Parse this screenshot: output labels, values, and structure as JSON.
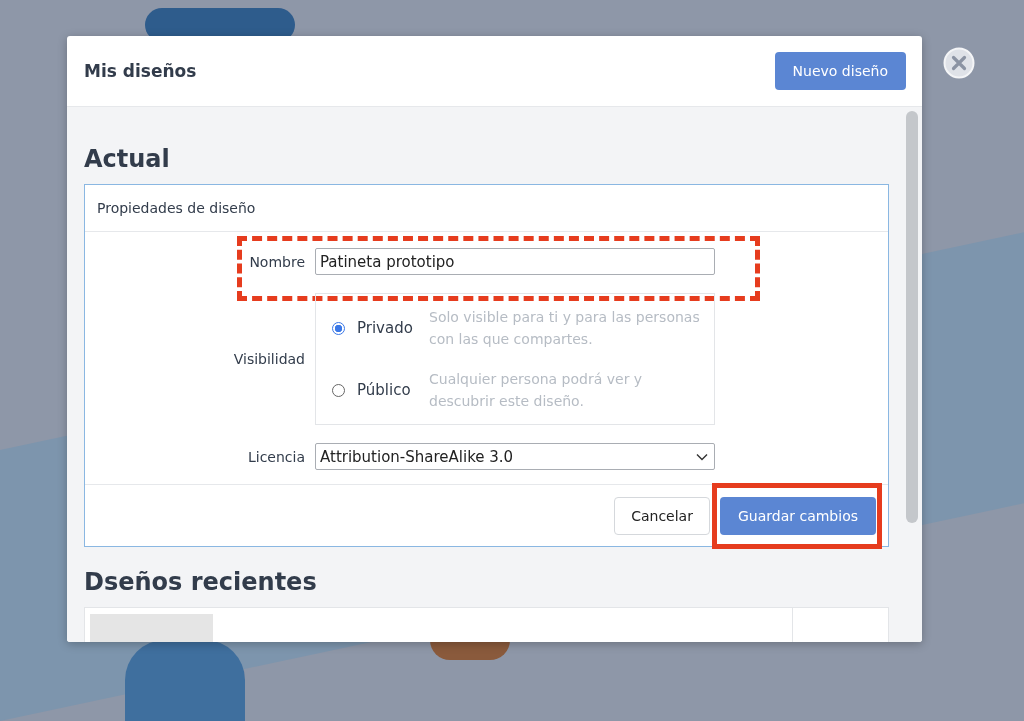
{
  "dialog": {
    "title": "Mis diseños",
    "new_button": "Nuevo diseño"
  },
  "current": {
    "heading": "Actual",
    "card_title": "Propiedades de diseño",
    "name": {
      "label": "Nombre",
      "value": "Patineta prototipo",
      "highlighted": true
    },
    "visibility": {
      "label": "Visibilidad",
      "options": [
        {
          "label": "Privado",
          "description": "Solo visible para ti y para las personas con las que compartes.",
          "selected": true
        },
        {
          "label": "Público",
          "description": "Cualquier persona podrá ver y descubrir este diseño.",
          "selected": false
        }
      ]
    },
    "license": {
      "label": "Licencia",
      "value": "Attribution-ShareAlike 3.0"
    },
    "cancel_button": "Cancelar",
    "save_button": {
      "label": "Guardar cambios",
      "highlighted": true
    }
  },
  "recent": {
    "heading": "Dseños recientes"
  }
}
